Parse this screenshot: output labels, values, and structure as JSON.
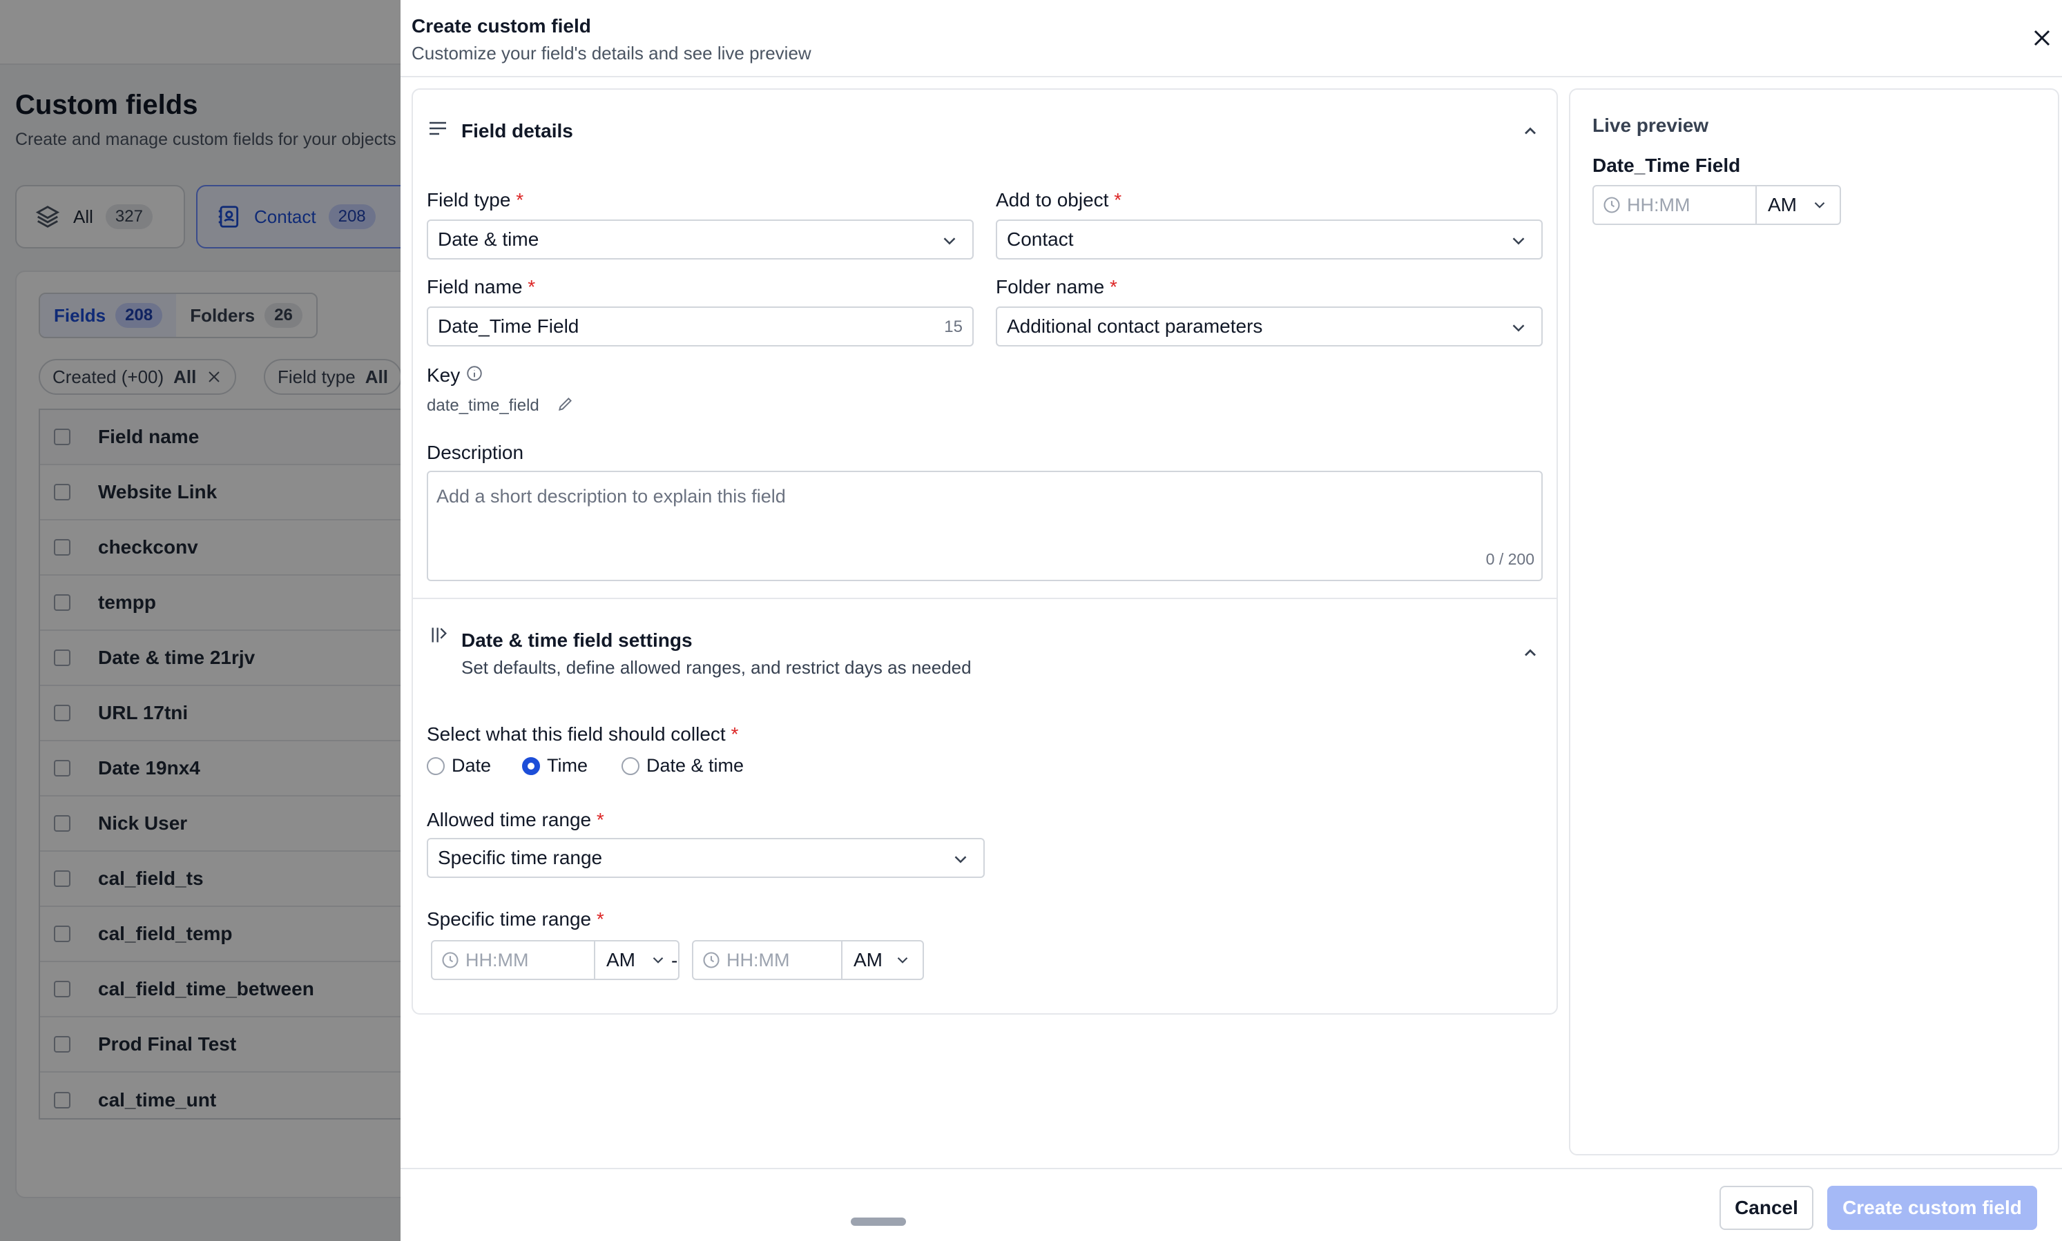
{
  "background": {
    "title": "Custom fields",
    "subtitle": "Create and manage custom fields for your objects",
    "object_tabs": [
      {
        "label": "All",
        "count": "327"
      },
      {
        "label": "Contact",
        "count": "208"
      }
    ],
    "view_tabs": [
      {
        "label": "Fields",
        "count": "208"
      },
      {
        "label": "Folders",
        "count": "26"
      }
    ],
    "filters": [
      {
        "label": "Created (+00)",
        "value": "All"
      },
      {
        "label": "Field type",
        "value": "All"
      }
    ],
    "table": {
      "header": "Field name",
      "rows": [
        "Website Link",
        "checkconv",
        "tempp",
        "Date & time 21rjv",
        "URL 17tni",
        "Date 19nx4",
        "Nick User",
        "cal_field_ts",
        "cal_field_temp",
        "cal_field_time_between",
        "Prod Final Test",
        "cal_time_unt"
      ]
    }
  },
  "drawer": {
    "title": "Create custom field",
    "subtitle": "Customize your field's details and see live preview",
    "field_details": {
      "heading": "Field details",
      "field_type_label": "Field type",
      "field_type_value": "Date & time",
      "add_to_object_label": "Add to object",
      "add_to_object_value": "Contact",
      "field_name_label": "Field name",
      "field_name_value": "Date_Time Field",
      "field_name_count": "15",
      "folder_name_label": "Folder name",
      "folder_name_value": "Additional contact parameters",
      "key_label": "Key",
      "key_value": "date_time_field",
      "description_label": "Description",
      "description_placeholder": "Add a short description to explain this field",
      "description_count": "0 / 200"
    },
    "settings": {
      "heading": "Date & time field settings",
      "subheading": "Set defaults, define allowed ranges, and restrict days as needed",
      "collect_label": "Select what this field should collect",
      "options": [
        "Date",
        "Time",
        "Date & time"
      ],
      "selected": "Time",
      "allowed_range_label": "Allowed time range",
      "allowed_range_value": "Specific time range",
      "specific_range_label": "Specific time range",
      "start_placeholder": "HH:MM",
      "start_ampm": "AM",
      "separator": "-",
      "end_placeholder": "HH:MM",
      "end_ampm": "AM"
    },
    "preview": {
      "heading": "Live preview",
      "field_label": "Date_Time Field",
      "placeholder": "HH:MM",
      "ampm": "AM"
    },
    "footer": {
      "cancel": "Cancel",
      "create": "Create custom field"
    },
    "required_mark": "*"
  },
  "colors": {
    "accent": "#1d4ed8",
    "required": "#dc2626",
    "disabled_button": "#a5b9f6"
  }
}
